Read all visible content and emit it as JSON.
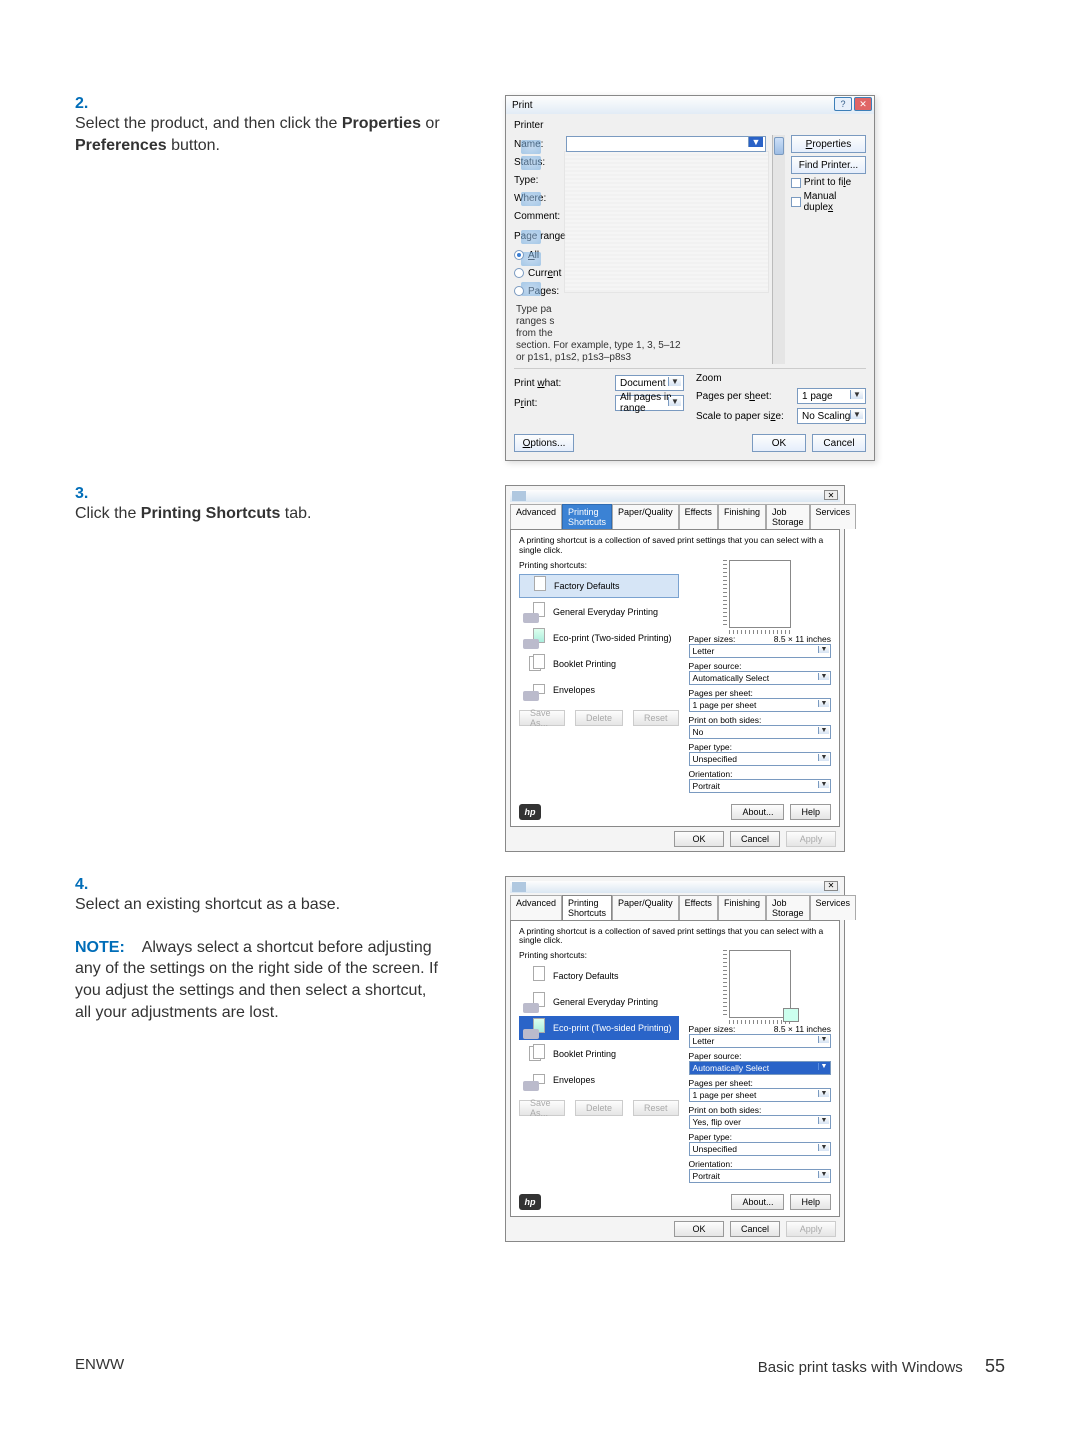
{
  "steps": {
    "s2": {
      "num": "2.",
      "body_a": "Select the product, and then click the ",
      "body_b": "Properties",
      "body_c": " or ",
      "body_d": "Preferences",
      "body_e": " button."
    },
    "s3": {
      "num": "3.",
      "body_a": "Click the ",
      "body_b": "Printing Shortcuts",
      "body_c": " tab."
    },
    "s4": {
      "num": "4.",
      "body": "Select an existing shortcut as a base.",
      "note_label": "NOTE:",
      "note": "Always select a shortcut before adjusting any of the settings on the right side of the screen. If you adjust the settings and then select a shortcut, all your adjustments are lost."
    }
  },
  "print_dialog": {
    "title": "Print",
    "printer_label": "Printer",
    "name_label": "Name:",
    "status_label": "Status:",
    "type_label": "Type:",
    "where_label": "Where:",
    "comment_label": "Comment:",
    "properties_btn": "Properties",
    "find_printer_btn": "Find Printer...",
    "print_to_file": "Print to file",
    "manual_duplex": "Manual duplex",
    "page_range_label": "Page range",
    "all": "All",
    "current": "Current",
    "pages": "Pages:",
    "range_desc_a": "Type pa",
    "range_desc_b": "ranges s",
    "range_desc_c": "from the",
    "range_desc_d": "section. For example, type 1, 3, 5–12",
    "range_desc_e": "or p1s1, p1s2, p1s3–p8s3",
    "print_what_label": "Print what:",
    "print_what_val": "Document",
    "print_label": "Print:",
    "print_val": "All pages in range",
    "zoom_label": "Zoom",
    "pps_label": "Pages per sheet:",
    "pps_val": "1 page",
    "scale_label": "Scale to paper size:",
    "scale_val": "No Scaling",
    "options_btn": "Options...",
    "ok_btn": "OK",
    "cancel_btn": "Cancel"
  },
  "shortcuts_dialog": {
    "tabs": [
      "Advanced",
      "Printing Shortcuts",
      "Paper/Quality",
      "Effects",
      "Finishing",
      "Job Storage",
      "Services"
    ],
    "desc": "A printing shortcut is a collection of saved print settings that you can select with a single click.",
    "list_label": "Printing shortcuts:",
    "items": [
      "Factory Defaults",
      "General Everyday Printing",
      "Eco-print (Two-sided Printing)",
      "Booklet Printing",
      "Envelopes"
    ],
    "paper_sizes_label": "Paper sizes:",
    "paper_sizes_dim": "8.5 × 11 inches",
    "paper_sizes_val": "Letter",
    "paper_source_label": "Paper source:",
    "paper_source_val": "Automatically Select",
    "pps_label": "Pages per sheet:",
    "pps_val": "1 page per sheet",
    "both_label": "Print on both sides:",
    "both_val_no": "No",
    "both_val_yes": "Yes, flip over",
    "ptype_label": "Paper type:",
    "ptype_val": "Unspecified",
    "orient_label": "Orientation:",
    "orient_val": "Portrait",
    "save_btn": "Save As...",
    "delete_btn": "Delete",
    "reset_btn": "Reset",
    "about_btn": "About...",
    "help_btn": "Help",
    "ok_btn": "OK",
    "cancel_btn": "Cancel",
    "apply_btn": "Apply"
  },
  "footer": {
    "left": "ENWW",
    "right": "Basic print tasks with Windows",
    "page": "55"
  }
}
